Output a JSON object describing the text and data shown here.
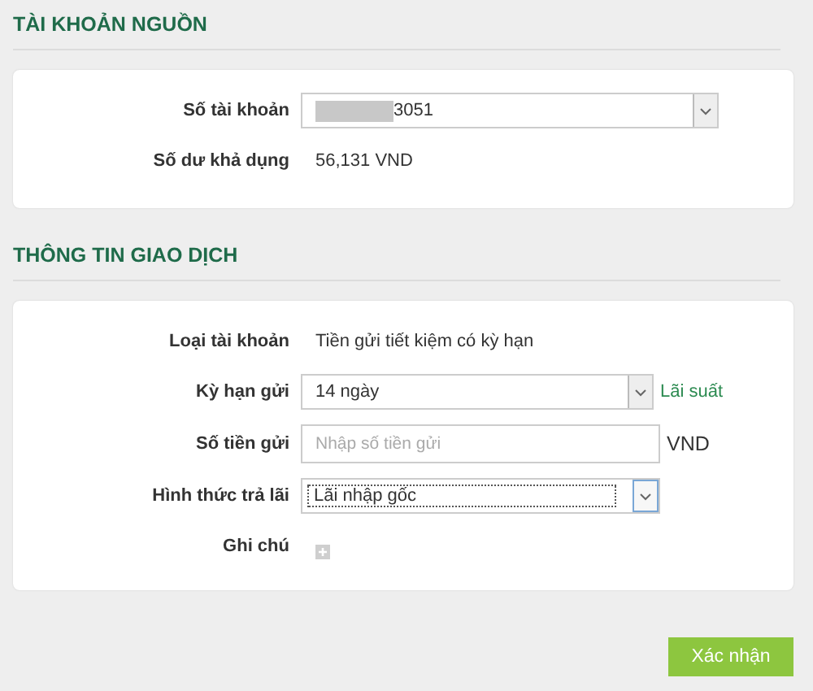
{
  "source_account": {
    "title": "TÀI KHOẢN NGUỒN",
    "rows": [
      {
        "kind": "select",
        "label": "Số tài khoản",
        "value": "3051",
        "masked": true
      },
      {
        "kind": "text",
        "label": "Số dư khả dụng",
        "value": "56,131 VND"
      }
    ]
  },
  "transaction_info": {
    "title": "THÔNG TIN GIAO DỊCH",
    "rows": [
      {
        "kind": "text",
        "label": "Loại tài khoản",
        "value": "Tiền gửi tiết kiệm có kỳ hạn"
      },
      {
        "kind": "select",
        "label": "Kỳ hạn gửi",
        "value": "14 ngày",
        "link": "Lãi suất"
      },
      {
        "kind": "input",
        "label": "Số tiền gửi",
        "placeholder": "Nhập số tiền gửi",
        "unit": "VND"
      },
      {
        "kind": "select",
        "label": "Hình thức trả lãi",
        "value": "Lãi nhập gốc",
        "focused": true
      },
      {
        "kind": "note",
        "label": "Ghi chú"
      }
    ]
  },
  "buttons": [
    "Xác nhận"
  ]
}
